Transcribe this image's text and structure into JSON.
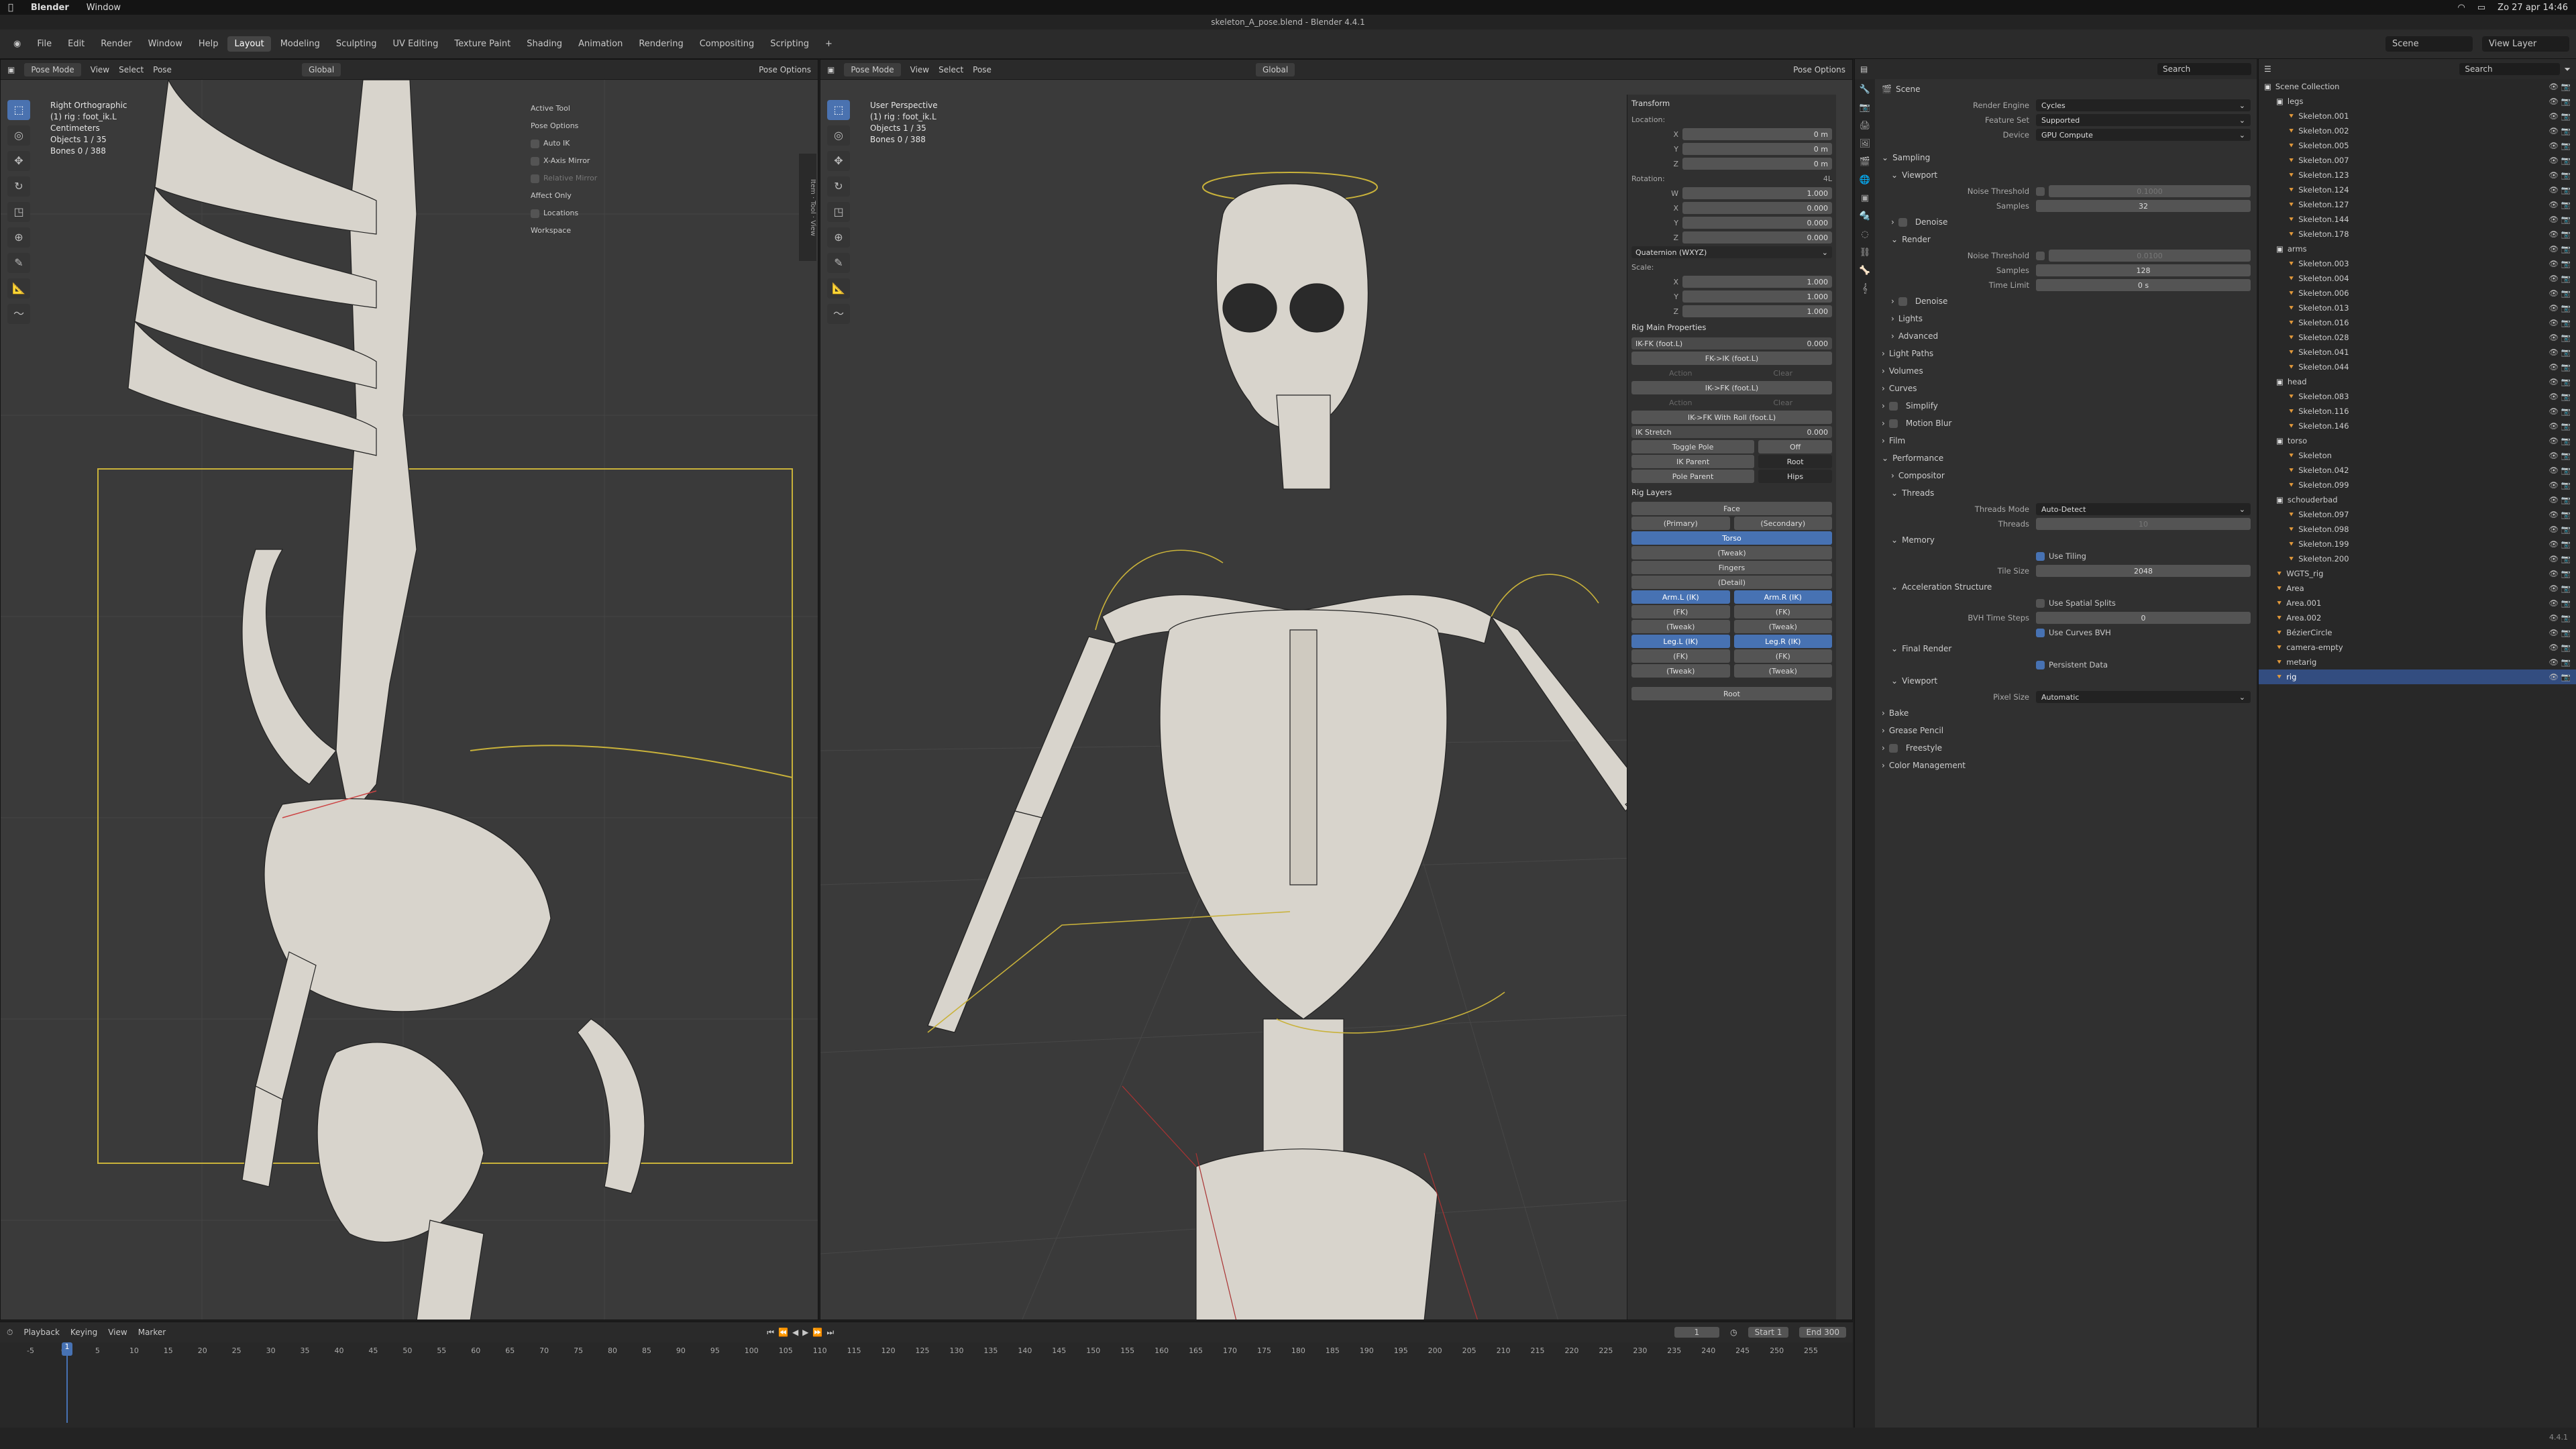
{
  "macbar": {
    "apple": "",
    "app": "Blender",
    "menu": "Window",
    "datetime": "Zo 27 apr 14:46"
  },
  "title": "skeleton_A_pose.blend - Blender 4.4.1",
  "menu": {
    "items": [
      "File",
      "Edit",
      "Render",
      "Window",
      "Help"
    ],
    "workspaces": [
      "Layout",
      "Modeling",
      "Sculpting",
      "UV Editing",
      "Texture Paint",
      "Shading",
      "Animation",
      "Rendering",
      "Compositing",
      "Scripting"
    ],
    "active_workspace": "Layout",
    "add": "+",
    "scene": "Scene",
    "view_layer": "View Layer"
  },
  "left_vp": {
    "mode": "Pose Mode",
    "menus": [
      "View",
      "Select",
      "Pose"
    ],
    "orientation": "Global",
    "pose_options": "Pose Options",
    "info": [
      "Right Orthographic",
      "(1) rig : foot_ik.L",
      "Centimeters",
      "Objects   1 / 35",
      "Bones     0 / 388"
    ],
    "popup": {
      "active_tool": "Active Tool",
      "pose_options": "Pose Options",
      "auto_ik": "Auto IK",
      "x_axis_mirror": "X-Axis Mirror",
      "relative_mirror": "Relative Mirror",
      "affect_only": "Affect Only",
      "locations": "Locations",
      "workspace": "Workspace"
    }
  },
  "right_vp": {
    "mode": "Pose Mode",
    "menus": [
      "View",
      "Select",
      "Pose"
    ],
    "orientation": "Global",
    "pose_options": "Pose Options",
    "info": [
      "User Perspective",
      "(1) rig : foot_ik.L",
      "Objects   1 / 35",
      "Bones     0 / 388"
    ],
    "tabs": [
      "Item",
      "Tool",
      "View"
    ]
  },
  "npanel": {
    "transform": "Transform",
    "location": "Location:",
    "loc": [
      "0 m",
      "0 m",
      "0 m"
    ],
    "rotation": "Rotation:",
    "rot_mode": "4L",
    "rot": [
      "1.000",
      "0.000",
      "0.000",
      "0.000"
    ],
    "rot_labels": [
      "W",
      "X",
      "Y",
      "Z"
    ],
    "quat": "Quaternion (WXYZ)",
    "scale": "Scale:",
    "scl": [
      "1.000",
      "1.000",
      "1.000"
    ],
    "rig_main": "Rig Main Properties",
    "ikfk": "IK-FK (foot.L)",
    "ikfk_val": "0.000",
    "fk_ik": "FK->IK (foot.L)",
    "action": "Action",
    "clear": "Clear",
    "ik_fk": "IK->FK (foot.L)",
    "ik_fk_roll": "IK->FK With Roll (foot.L)",
    "ik_stretch": "IK Stretch",
    "ik_stretch_val": "0.000",
    "toggle_pole": "Toggle Pole",
    "toggle_val": "Off",
    "ik_parent": "IK Parent",
    "ik_parent_val": "Root",
    "pole_parent": "Pole Parent",
    "pole_parent_val": "Hips",
    "rig_layers": "Rig Layers",
    "face": "Face",
    "primary": "(Primary)",
    "secondary": "(Secondary)",
    "torso": "Torso",
    "tweak": "(Tweak)",
    "fingers": "Fingers",
    "detail": "(Detail)",
    "arm_l": "Arm.L (IK)",
    "arm_r": "Arm.R (IK)",
    "fk": "(FK)",
    "leg_l": "Leg.L (IK)",
    "leg_r": "Leg.R (IK)",
    "root": "Root"
  },
  "props": {
    "scene": "Scene",
    "search": "Search",
    "render_engine": "Render Engine",
    "engine": "Cycles",
    "feature_set": "Feature Set",
    "feature": "Supported",
    "device": "Device",
    "device_val": "GPU Compute",
    "sampling": "Sampling",
    "viewport": "Viewport",
    "noise_threshold": "Noise Threshold",
    "vp_noise": "0.1000",
    "samples": "Samples",
    "vp_samples": "32",
    "denoise": "Denoise",
    "render": "Render",
    "r_noise": "0.0100",
    "r_samples": "128",
    "time_limit": "Time Limit",
    "time_val": "0 s",
    "lights": "Lights",
    "advanced": "Advanced",
    "light_paths": "Light Paths",
    "volumes": "Volumes",
    "curves": "Curves",
    "simplify": "Simplify",
    "motion_blur": "Motion Blur",
    "film": "Film",
    "performance": "Performance",
    "compositor": "Compositor",
    "threads": "Threads",
    "threads_mode": "Threads Mode",
    "threads_mode_val": "Auto-Detect",
    "threads_lbl": "Threads",
    "threads_val": "10",
    "memory": "Memory",
    "use_tiling": "Use Tiling",
    "tile_size": "Tile Size",
    "tile_val": "2048",
    "accel": "Acceleration Structure",
    "spatial": "Use Spatial Splits",
    "bvh": "BVH Time Steps",
    "bvh_val": "0",
    "curves_bvh": "Use Curves BVH",
    "final_render": "Final Render",
    "persistent": "Persistent Data",
    "viewport2": "Viewport",
    "pixel_size": "Pixel Size",
    "pixel_val": "Automatic",
    "bake": "Bake",
    "grease": "Grease Pencil",
    "freestyle": "Freestyle",
    "color_mgmt": "Color Management"
  },
  "outliner": {
    "search": "Search",
    "rows": [
      {
        "t": "Scene Collection",
        "d": 0,
        "c": 1
      },
      {
        "t": "legs",
        "d": 1,
        "c": 1
      },
      {
        "t": "Skeleton.001",
        "d": 2
      },
      {
        "t": "Skeleton.002",
        "d": 2
      },
      {
        "t": "Skeleton.005",
        "d": 2
      },
      {
        "t": "Skeleton.007",
        "d": 2
      },
      {
        "t": "Skeleton.123",
        "d": 2
      },
      {
        "t": "Skeleton.124",
        "d": 2
      },
      {
        "t": "Skeleton.127",
        "d": 2
      },
      {
        "t": "Skeleton.144",
        "d": 2
      },
      {
        "t": "Skeleton.178",
        "d": 2
      },
      {
        "t": "arms",
        "d": 1,
        "c": 1
      },
      {
        "t": "Skeleton.003",
        "d": 2
      },
      {
        "t": "Skeleton.004",
        "d": 2
      },
      {
        "t": "Skeleton.006",
        "d": 2
      },
      {
        "t": "Skeleton.013",
        "d": 2
      },
      {
        "t": "Skeleton.016",
        "d": 2
      },
      {
        "t": "Skeleton.028",
        "d": 2
      },
      {
        "t": "Skeleton.041",
        "d": 2
      },
      {
        "t": "Skeleton.044",
        "d": 2
      },
      {
        "t": "head",
        "d": 1,
        "c": 1
      },
      {
        "t": "Skeleton.083",
        "d": 2
      },
      {
        "t": "Skeleton.116",
        "d": 2
      },
      {
        "t": "Skeleton.146",
        "d": 2
      },
      {
        "t": "torso",
        "d": 1,
        "c": 1
      },
      {
        "t": "Skeleton",
        "d": 2
      },
      {
        "t": "Skeleton.042",
        "d": 2
      },
      {
        "t": "Skeleton.099",
        "d": 2
      },
      {
        "t": "schouderbad",
        "d": 1,
        "c": 1
      },
      {
        "t": "Skeleton.097",
        "d": 2
      },
      {
        "t": "Skeleton.098",
        "d": 2
      },
      {
        "t": "Skeleton.199",
        "d": 2
      },
      {
        "t": "Skeleton.200",
        "d": 2
      },
      {
        "t": "WGTS_rig",
        "d": 1
      },
      {
        "t": "Area",
        "d": 1
      },
      {
        "t": "Area.001",
        "d": 1
      },
      {
        "t": "Area.002",
        "d": 1
      },
      {
        "t": "BézierCircle",
        "d": 1
      },
      {
        "t": "camera-empty",
        "d": 1
      },
      {
        "t": "metarig",
        "d": 1
      },
      {
        "t": "rig",
        "d": 1,
        "s": 1
      }
    ]
  },
  "timeline": {
    "menus": [
      "Playback",
      "Keying",
      "View",
      "Marker"
    ],
    "frame": "1",
    "start_lbl": "Start",
    "start": "1",
    "end_lbl": "End",
    "end": "300",
    "ticks": [
      "-5",
      "0",
      "5",
      "10",
      "15",
      "20",
      "25",
      "30",
      "35",
      "40",
      "45",
      "50",
      "55",
      "60",
      "65",
      "70",
      "75",
      "80",
      "85",
      "90",
      "95",
      "100",
      "105",
      "110",
      "115",
      "120",
      "125",
      "130",
      "135",
      "140",
      "145",
      "150",
      "155",
      "160",
      "165",
      "170",
      "175",
      "180",
      "185",
      "190",
      "195",
      "200",
      "205",
      "210",
      "215",
      "220",
      "225",
      "230",
      "235",
      "240",
      "245",
      "250",
      "255"
    ],
    "current": "1"
  },
  "version": "4.4.1"
}
